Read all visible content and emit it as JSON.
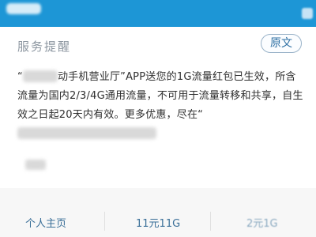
{
  "card": {
    "title": "服务提醒",
    "original_button": "原文",
    "message": {
      "open_quote": "“",
      "part1": "动手机营业厅”APP送您的1G流量红包已生效，所含流量为国内2/3/4G通用流量，不可用于流量转移和共享，自生效之日起20天内有效。更多优惠，尽在“"
    }
  },
  "bottom_tabs": [
    {
      "label": "个人主页"
    },
    {
      "label": "11元11G"
    },
    {
      "label": "2元1G"
    }
  ]
}
